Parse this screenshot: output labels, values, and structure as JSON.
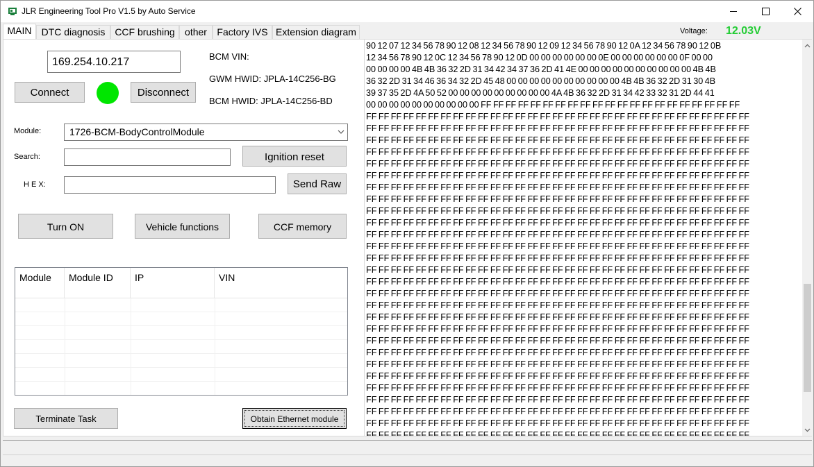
{
  "window": {
    "title": "JLR Engineering Tool Pro V1.5 by Auto Service"
  },
  "tabs": [
    {
      "label": "MAIN"
    },
    {
      "label": "DTC diagnosis"
    },
    {
      "label": "CCF brushing"
    },
    {
      "label": "other"
    },
    {
      "label": "Factory IVS"
    },
    {
      "label": "Extension diagram"
    }
  ],
  "voltage": {
    "label": "Voltage:",
    "value": "12.03V",
    "color": "#22cc33"
  },
  "connection": {
    "ip": "169.254.10.217",
    "connect_label": "Connect",
    "disconnect_label": "Disconnect",
    "status_color": "#00e600"
  },
  "info": {
    "bcm_vin": "BCM VIN:",
    "gwm_hwid": "GWM HWID: JPLA-14C256-BG",
    "bcm_hwid": "BCM HWID: JPLA-14C256-BD"
  },
  "form": {
    "module_label": "Module:",
    "module_value": "1726-BCM-BodyControlModule",
    "search_label": "Search:",
    "search_value": "",
    "hex_label": "H E X:",
    "hex_value": ""
  },
  "buttons": {
    "ignition_reset": "Ignition reset",
    "send_raw": "Send Raw",
    "turn_on": "Turn ON",
    "vehicle_functions": "Vehicle functions",
    "ccf_memory": "CCF memory",
    "terminate_task": "Terminate Task",
    "obtain_ethernet": "Obtain Ethernet module"
  },
  "table": {
    "columns": [
      "Module",
      "Module ID",
      "IP",
      "VIN"
    ],
    "rows": []
  },
  "hex_dump": [
    "90 12 07 12 34 56 78 90 12 08 12 34 56 78 90 12 09 12 34 56 78 90 12 0A 12 34 56 78 90 12 0B",
    "12 34 56 78 90 12 0C 12 34 56 78 90 12 0D 00 00 00 00 00 00 0E 00 00 00 00 00 00 0F 00 00",
    "00 00 00 00 4B 4B 36 32 2D 31 34 42 34 37 36 2D 41 4E 00 00 00 00 00 00 00 00 00 00 4B 4B",
    "36 32 2D 31 34 46 36 34 32 2D 45 48 00 00 00 00 00 00 00 00 00 00 4B 4B 36 32 2D 31 30 4B",
    "39 37 35 2D 4A 50 52 00 00 00 00 00 00 00 00 00 4A 4B 36 32 2D 31 34 42 33 32 31 2D 44 41",
    "00 00 00 00 00 00 00 00 00 00 FF FF FF FF FF FF FF FF FF FF FF FF FF FF FF FF FF FF FF FF FF",
    "FF FF FF FF FF FF FF FF FF FF FF FF FF FF FF FF FF FF FF FF FF FF FF FF FF FF FF FF FF FF FF",
    "FF FF FF FF FF FF FF FF FF FF FF FF FF FF FF FF FF FF FF FF FF FF FF FF FF FF FF FF FF FF FF",
    "FF FF FF FF FF FF FF FF FF FF FF FF FF FF FF FF FF FF FF FF FF FF FF FF FF FF FF FF FF FF FF",
    "FF FF FF FF FF FF FF FF FF FF FF FF FF FF FF FF FF FF FF FF FF FF FF FF FF FF FF FF FF FF FF",
    "FF FF FF FF FF FF FF FF FF FF FF FF FF FF FF FF FF FF FF FF FF FF FF FF FF FF FF FF FF FF FF",
    "FF FF FF FF FF FF FF FF FF FF FF FF FF FF FF FF FF FF FF FF FF FF FF FF FF FF FF FF FF FF FF",
    "FF FF FF FF FF FF FF FF FF FF FF FF FF FF FF FF FF FF FF FF FF FF FF FF FF FF FF FF FF FF FF",
    "FF FF FF FF FF FF FF FF FF FF FF FF FF FF FF FF FF FF FF FF FF FF FF FF FF FF FF FF FF FF FF",
    "FF FF FF FF FF FF FF FF FF FF FF FF FF FF FF FF FF FF FF FF FF FF FF FF FF FF FF FF FF FF FF",
    "FF FF FF FF FF FF FF FF FF FF FF FF FF FF FF FF FF FF FF FF FF FF FF FF FF FF FF FF FF FF FF",
    "FF FF FF FF FF FF FF FF FF FF FF FF FF FF FF FF FF FF FF FF FF FF FF FF FF FF FF FF FF FF FF",
    "FF FF FF FF FF FF FF FF FF FF FF FF FF FF FF FF FF FF FF FF FF FF FF FF FF FF FF FF FF FF FF",
    "FF FF FF FF FF FF FF FF FF FF FF FF FF FF FF FF FF FF FF FF FF FF FF FF FF FF FF FF FF FF FF",
    "FF FF FF FF FF FF FF FF FF FF FF FF FF FF FF FF FF FF FF FF FF FF FF FF FF FF FF FF FF FF FF",
    "FF FF FF FF FF FF FF FF FF FF FF FF FF FF FF FF FF FF FF FF FF FF FF FF FF FF FF FF FF FF FF",
    "FF FF FF FF FF FF FF FF FF FF FF FF FF FF FF FF FF FF FF FF FF FF FF FF FF FF FF FF FF FF FF",
    "FF FF FF FF FF FF FF FF FF FF FF FF FF FF FF FF FF FF FF FF FF FF FF FF FF FF FF FF FF FF FF",
    "FF FF FF FF FF FF FF FF FF FF FF FF FF FF FF FF FF FF FF FF FF FF FF FF FF FF FF FF FF FF FF",
    "FF FF FF FF FF FF FF FF FF FF FF FF FF FF FF FF FF FF FF FF FF FF FF FF FF FF FF FF FF FF FF",
    "FF FF FF FF FF FF FF FF FF FF FF FF FF FF FF FF FF FF FF FF FF FF FF FF FF FF FF FF FF FF FF",
    "FF FF FF FF FF FF FF FF FF FF FF FF FF FF FF FF FF FF FF FF FF FF FF FF FF FF FF FF FF FF FF",
    "FF FF FF FF FF FF FF FF FF FF FF FF FF FF FF FF FF FF FF FF FF FF FF FF FF FF FF FF FF FF FF",
    "FF FF FF FF FF FF FF FF FF FF FF FF FF FF FF FF FF FF FF FF FF FF FF FF FF FF FF FF FF FF FF",
    "FF FF FF FF FF FF FF FF FF FF FF FF FF FF FF FF FF FF FF FF FF FF FF FF FF FF FF FF FF FF FF",
    "FF FF FF FF FF FF FF FF FF FF FF FF FF FF FF FF FF FF FF FF FF FF FF FF FF FF FF FF FF FF FF",
    "FF FF FF FF FF FF FF FF FF FF FF FF FF FF FF FF FF FF FF FF FF FF FF FF FF FF FF FF FF FF FF",
    "FF FF FF FF FF FF FF FF FF FF FF FF FF FF FF FF FF FF FF FF FF FF FF FF FF FF FF FF FF FF FF",
    "FF FF FF FF FF FF FF FF FF FF FF FF FF FF FF FF FF FF FF FF FF FF FF FF FF FF FF FF FF FF FF"
  ],
  "icons": {
    "app": "app-icon",
    "minimize": "minimize-icon",
    "maximize": "maximize-icon",
    "close": "close-icon",
    "dropdown": "chevron-down-icon",
    "scroll_up": "scroll-up-icon",
    "scroll_down": "scroll-down-icon"
  }
}
